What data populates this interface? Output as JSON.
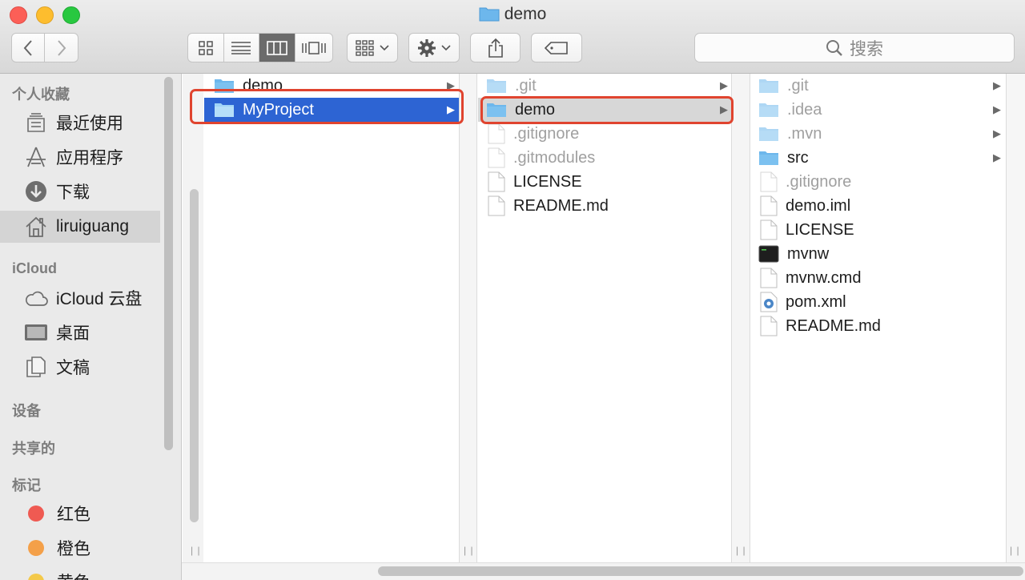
{
  "window": {
    "title": "demo"
  },
  "toolbar": {
    "search_placeholder": "搜索"
  },
  "sidebar": {
    "sections": [
      {
        "header": "个人收藏",
        "items": [
          {
            "label": "最近使用",
            "icon": "recents-icon"
          },
          {
            "label": "应用程序",
            "icon": "applications-icon"
          },
          {
            "label": "下载",
            "icon": "downloads-icon"
          },
          {
            "label": "liruiguang",
            "icon": "home-icon",
            "selected": true
          }
        ]
      },
      {
        "header": "iCloud",
        "items": [
          {
            "label": "iCloud 云盘",
            "icon": "cloud-icon"
          },
          {
            "label": "桌面",
            "icon": "desktop-icon"
          },
          {
            "label": "文稿",
            "icon": "documents-icon"
          }
        ]
      },
      {
        "header": "设备",
        "items": []
      },
      {
        "header": "共享的",
        "items": []
      },
      {
        "header": "标记",
        "items": [
          {
            "label": "红色",
            "color": "#ef5a52"
          },
          {
            "label": "橙色",
            "color": "#f4a049"
          },
          {
            "label": "黄色",
            "color": "#f4c94a"
          }
        ]
      }
    ]
  },
  "columns": [
    {
      "items": [
        {
          "name": "demo",
          "type": "folder",
          "has_children": true
        },
        {
          "name": "MyProject",
          "type": "folder",
          "has_children": true,
          "selected": "active"
        }
      ]
    },
    {
      "items": [
        {
          "name": ".git",
          "type": "folder",
          "hidden": true,
          "has_children": true
        },
        {
          "name": "demo",
          "type": "folder",
          "has_children": true,
          "selected": "inactive"
        },
        {
          "name": ".gitignore",
          "type": "file",
          "hidden": true
        },
        {
          "name": ".gitmodules",
          "type": "file",
          "hidden": true
        },
        {
          "name": "LICENSE",
          "type": "file"
        },
        {
          "name": "README.md",
          "type": "file"
        }
      ]
    },
    {
      "items": [
        {
          "name": ".git",
          "type": "folder",
          "hidden": true,
          "has_children": true
        },
        {
          "name": ".idea",
          "type": "folder",
          "hidden": true,
          "has_children": true
        },
        {
          "name": ".mvn",
          "type": "folder",
          "hidden": true,
          "has_children": true
        },
        {
          "name": "src",
          "type": "folder",
          "has_children": true
        },
        {
          "name": ".gitignore",
          "type": "file",
          "hidden": true
        },
        {
          "name": "demo.iml",
          "type": "file"
        },
        {
          "name": "LICENSE",
          "type": "file"
        },
        {
          "name": "mvnw",
          "type": "exec"
        },
        {
          "name": "mvnw.cmd",
          "type": "file"
        },
        {
          "name": "pom.xml",
          "type": "xml"
        },
        {
          "name": "README.md",
          "type": "file"
        }
      ]
    }
  ],
  "colors": {
    "selection_blue": "#2d64d3",
    "highlight_red": "#e0442f",
    "folder_blue": "#6db7ec"
  }
}
